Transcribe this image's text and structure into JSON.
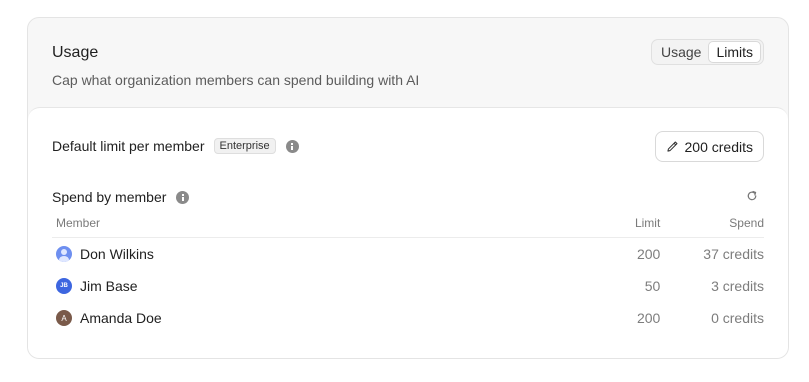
{
  "panel": {
    "title": "Usage",
    "subtitle": "Cap what organization members can spend building with AI",
    "tabs": [
      {
        "label": "Usage",
        "active": false
      },
      {
        "label": "Limits",
        "active": true
      }
    ]
  },
  "default_limit": {
    "label": "Default limit per member",
    "badge": "Enterprise",
    "info_icon": "info-icon",
    "button_label": "200 credits",
    "button_icon": "pencil-icon"
  },
  "spend": {
    "title": "Spend by member",
    "info_icon": "info-icon",
    "refresh_icon": "refresh-icon",
    "columns": {
      "member": "Member",
      "limit": "Limit",
      "spend": "Spend"
    },
    "rows": [
      {
        "name": "Don Wilkins",
        "avatar": "",
        "limit": "200",
        "spend": "37 credits"
      },
      {
        "name": "Jim Base",
        "avatar": "JB",
        "limit": "50",
        "spend": "3 credits"
      },
      {
        "name": "Amanda Doe",
        "avatar": "A",
        "limit": "200",
        "spend": "0 credits"
      }
    ]
  }
}
